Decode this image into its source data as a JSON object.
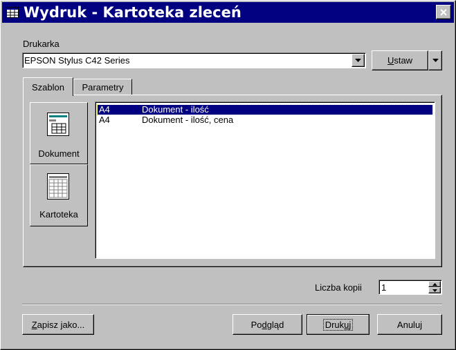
{
  "window": {
    "title": "Wydruk - Kartoteka zleceń",
    "close": "×"
  },
  "printer": {
    "label": "Drukarka",
    "selected": "EPSON Stylus C42 Series",
    "setup_prefix": "",
    "setup_u": "U",
    "setup_rest": "staw"
  },
  "tabs": [
    {
      "label": "Szablon"
    },
    {
      "label": "Parametry"
    }
  ],
  "sidebar": [
    {
      "label": "Dokument"
    },
    {
      "label": "Kartoteka"
    }
  ],
  "templates": [
    {
      "size": "A4",
      "name": "Dokument - ilość"
    },
    {
      "size": "A4",
      "name": "Dokument - ilość, cena"
    }
  ],
  "copies": {
    "label": "Liczba kopii",
    "value": "1"
  },
  "buttons": {
    "save_as_u": "Z",
    "save_as_rest": "apisz jako...",
    "preview_a": "Po",
    "preview_u": "d",
    "preview_b": "gląd",
    "print_a": "Druk",
    "print_u": "u",
    "print_b": "j",
    "cancel": "Anuluj"
  }
}
